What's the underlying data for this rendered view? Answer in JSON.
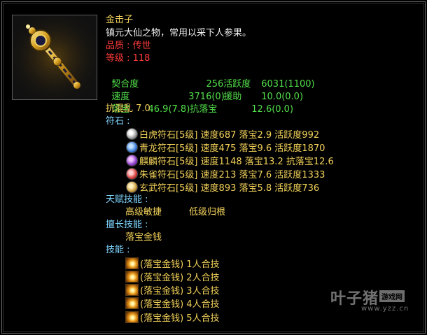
{
  "item": {
    "name": "金击子",
    "description": "镇元大仙之物，常用以采下人参果。",
    "quality": "品质 : 传世",
    "level": "等级 : 118",
    "stats": [
      {
        "label": "契合度",
        "value": "256",
        "label2": "活跃度",
        "value2": "6031(1100)"
      },
      {
        "label": "速度",
        "value": "3716(0)",
        "label2": "援助",
        "value2": "10.0(0.0)"
      },
      {
        "label": "落宝",
        "value": "46.9(7.8)",
        "label2": "抗落宝",
        "value2": "12.6(0.0)"
      }
    ],
    "resist": "抗混乱 7.0",
    "runes_header": "符石 :",
    "runes": [
      {
        "icon": "white-tiger-rune-icon",
        "color": "#d8d8d8",
        "text": "白虎符石[5级] 速度687 落宝2.9 活跃度992"
      },
      {
        "icon": "azure-dragon-rune-icon",
        "color": "#3a7ad8",
        "text": "青龙符石[5级] 速度475 落宝9.6 活跃度1870"
      },
      {
        "icon": "qilin-rune-icon",
        "color": "#8a3ac8",
        "text": "麒麟符石[5级] 速度1148 落宝13.2 抗落宝12.6"
      },
      {
        "icon": "vermilion-bird-rune-icon",
        "color": "#d83a3a",
        "text": "朱雀符石[5级] 速度213 落宝7.6 活跃度1333"
      },
      {
        "icon": "black-tortoise-rune-icon",
        "color": "#c89a3a",
        "text": "玄武符石[5级] 速度893 落宝5.8 活跃度736"
      }
    ],
    "talent_header": "天赋技能 :",
    "talents": [
      "高级敏捷",
      "低级归根"
    ],
    "specialty_header": "擅长技能 :",
    "specialty": "落宝金钱",
    "skills_header": "技能 :",
    "skills": [
      "(落宝金钱) 1人合技",
      "(落宝金钱) 2人合技",
      "(落宝金钱) 3人合技",
      "(落宝金钱) 4人合技",
      "(落宝金钱) 5人合技"
    ]
  },
  "watermark": {
    "title": "叶子猪",
    "badge": "游戏网",
    "url": "www.yzz.cn"
  }
}
